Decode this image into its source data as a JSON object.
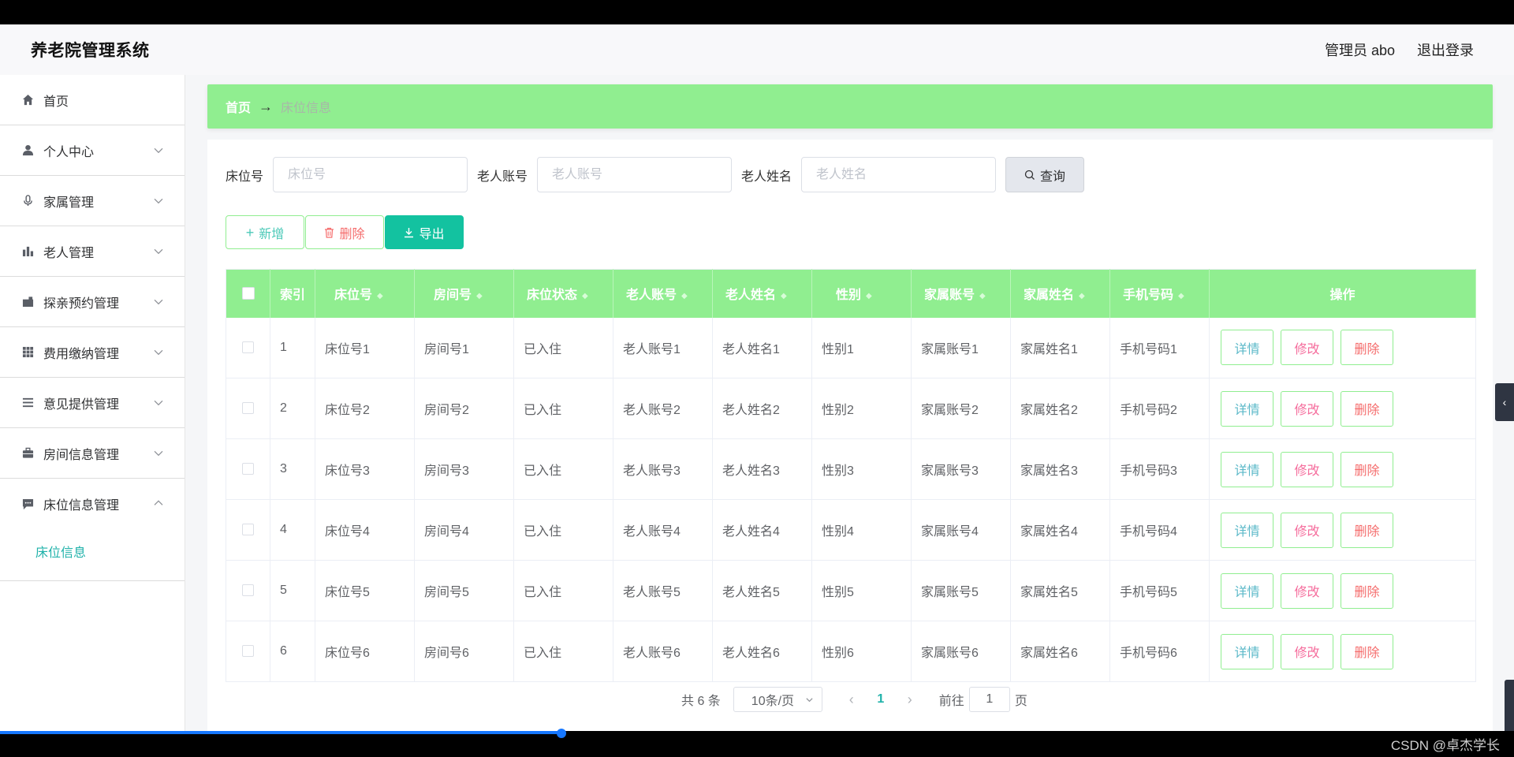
{
  "header": {
    "title": "养老院管理系统",
    "user": "管理员 abo",
    "logout": "退出登录"
  },
  "sidebar": {
    "items": [
      {
        "label": "首页",
        "icon": "home-icon"
      },
      {
        "label": "个人中心",
        "icon": "user-icon"
      },
      {
        "label": "家属管理",
        "icon": "microphone-icon"
      },
      {
        "label": "老人管理",
        "icon": "bar-chart-icon"
      },
      {
        "label": "探亲预约管理",
        "icon": "briefcase-icon"
      },
      {
        "label": "费用缴纳管理",
        "icon": "grid-icon"
      },
      {
        "label": "意见提供管理",
        "icon": "list-icon"
      },
      {
        "label": "房间信息管理",
        "icon": "suitcase-icon"
      },
      {
        "label": "床位信息管理",
        "icon": "chat-icon"
      }
    ],
    "submenu": {
      "label": "床位信息"
    }
  },
  "breadcrumb": {
    "home": "首页",
    "arrow": "→",
    "current": "床位信息"
  },
  "search": {
    "bed_label": "床位号",
    "bed_placeholder": "床位号",
    "account_label": "老人账号",
    "account_placeholder": "老人账号",
    "name_label": "老人姓名",
    "name_placeholder": "老人姓名",
    "query_button": "查询"
  },
  "actions": {
    "add": "新增",
    "delete": "删除",
    "export": "导出"
  },
  "table": {
    "headers": [
      "索引",
      "床位号",
      "房间号",
      "床位状态",
      "老人账号",
      "老人姓名",
      "性别",
      "家属账号",
      "家属姓名",
      "手机号码",
      "操作"
    ],
    "rows": [
      [
        "1",
        "床位号1",
        "房间号1",
        "已入住",
        "老人账号1",
        "老人姓名1",
        "性别1",
        "家属账号1",
        "家属姓名1",
        "手机号码1"
      ],
      [
        "2",
        "床位号2",
        "房间号2",
        "已入住",
        "老人账号2",
        "老人姓名2",
        "性别2",
        "家属账号2",
        "家属姓名2",
        "手机号码2"
      ],
      [
        "3",
        "床位号3",
        "房间号3",
        "已入住",
        "老人账号3",
        "老人姓名3",
        "性别3",
        "家属账号3",
        "家属姓名3",
        "手机号码3"
      ],
      [
        "4",
        "床位号4",
        "房间号4",
        "已入住",
        "老人账号4",
        "老人姓名4",
        "性别4",
        "家属账号4",
        "家属姓名4",
        "手机号码4"
      ],
      [
        "5",
        "床位号5",
        "房间号5",
        "已入住",
        "老人账号5",
        "老人姓名5",
        "性别5",
        "家属账号5",
        "家属姓名5",
        "手机号码5"
      ],
      [
        "6",
        "床位号6",
        "房间号6",
        "已入住",
        "老人账号6",
        "老人姓名6",
        "性别6",
        "家属账号6",
        "家属姓名6",
        "手机号码6"
      ]
    ],
    "op_labels": {
      "detail": "详情",
      "edit": "修改",
      "remove": "删除"
    }
  },
  "pagination": {
    "total": "共 6 条",
    "page_size": "10条/页",
    "current_page": "1",
    "goto_prefix": "前往",
    "goto_value": "1",
    "goto_suffix": "页"
  },
  "watermark": "CSDN @卓杰学长",
  "colors": {
    "accent_green": "#90ee90",
    "teal": "#20b2aa",
    "export_button": "#13c2a0",
    "danger": "#f56c6c"
  }
}
